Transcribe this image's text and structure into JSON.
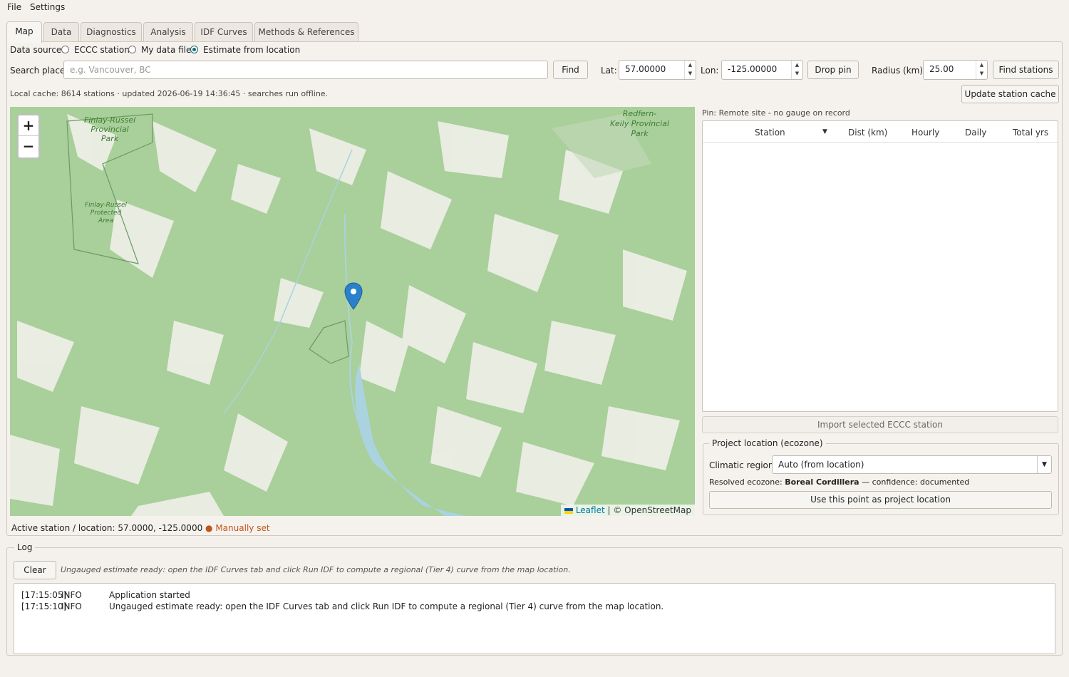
{
  "menu": {
    "file": "File",
    "settings": "Settings"
  },
  "tabs": [
    "Map",
    "Data",
    "Diagnostics",
    "Analysis",
    "IDF Curves",
    "Methods & References"
  ],
  "data_source": {
    "label": "Data source:",
    "options": [
      "ECCC station",
      "My data file",
      "Estimate from location"
    ],
    "selected": "Estimate from location"
  },
  "search": {
    "label": "Search place:",
    "placeholder": "e.g. Vancouver, BC",
    "find": "Find"
  },
  "lat": {
    "label": "Lat:",
    "value": "57.00000"
  },
  "lon": {
    "label": "Lon:",
    "value": "-125.00000"
  },
  "drop_pin": "Drop pin",
  "radius": {
    "label": "Radius (km):",
    "value": "25.00"
  },
  "find_stations": "Find stations",
  "cache": {
    "info": "Local cache: 8614 stations · updated 2026-06-19 14:36:45 · searches run offline.",
    "update": "Update station cache"
  },
  "map": {
    "zoom_in": "+",
    "zoom_out": "−",
    "labels": {
      "finlay_park": [
        "Finlay-Russel",
        "Provincial",
        "Park"
      ],
      "finlay_protected": [
        "Finlay-Russel",
        "Protected",
        "Area"
      ],
      "redfern": [
        "Redfern-",
        "Keily Provincial",
        "Park"
      ]
    },
    "attribution": {
      "leaflet": "Leaflet",
      "sep": " | © OpenStreetMap"
    }
  },
  "pin_status": "Pin: Remote site - no gauge on record",
  "station_table": {
    "columns": [
      "Station",
      "Dist (km)",
      "Hourly",
      "Daily",
      "Total yrs"
    ]
  },
  "import_button": "Import selected ECCC station",
  "project_location": {
    "title": "Project location (ecozone)",
    "region_label": "Climatic region:",
    "region_value": "Auto (from location)",
    "resolved_prefix": "Resolved ecozone: ",
    "resolved_ecozone": "Boreal Cordillera",
    "resolved_suffix": " — confidence: documented",
    "use_point": "Use this point as project location"
  },
  "active_station": {
    "text": "Active station / location: 57.0000, -125.0000",
    "flag": "● Manually set",
    "flag_color": "#c0561c"
  },
  "log": {
    "title": "Log",
    "clear": "Clear",
    "hint": "Ungauged estimate ready: open the IDF Curves tab and click Run IDF to compute a regional (Tier 4) curve from the map location.",
    "entries": [
      {
        "time": "[17:15:05]",
        "level": "INFO",
        "message": "Application started"
      },
      {
        "time": "[17:15:10]",
        "level": "INFO",
        "message": "Ungauged estimate ready: open the IDF Curves tab and click Run IDF to compute a regional (Tier 4) curve from the map location."
      }
    ]
  },
  "colors": {
    "accent": "#1d6b78",
    "map_forest": "#a9cf9a",
    "map_water": "#aad3df",
    "pin": "#2a81cb"
  }
}
